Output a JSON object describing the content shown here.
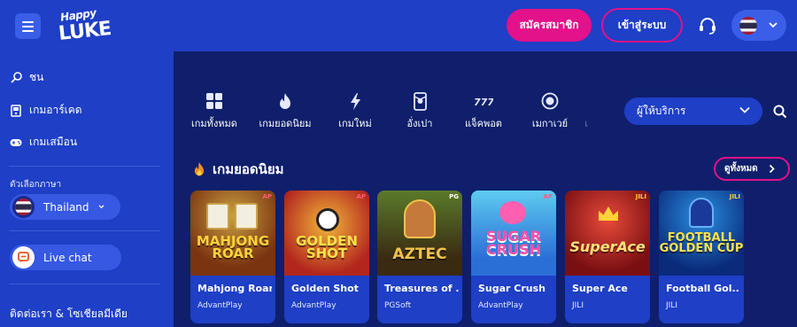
{
  "header": {
    "logo_line1": "Happy",
    "logo_line2": "LUKE",
    "register_label": "สมัครสมาชิก",
    "login_label": "เข้าสู่ระบบ"
  },
  "sidebar": {
    "items": [
      {
        "label": "ชน",
        "icon": "lollipop-icon"
      },
      {
        "label": "เกมอาร์เคด",
        "icon": "arcade-icon"
      },
      {
        "label": "เกมเสมือน",
        "icon": "gamepad-icon"
      }
    ],
    "language_title": "ตัวเลือกภาษา",
    "language_value": "Thailand",
    "live_chat_label": "Live chat",
    "contact_label": "ติดต่อเรา & โซเชียลมีเดีย"
  },
  "categories": [
    {
      "label": "เกมทั้งหมด",
      "icon": "grid-icon"
    },
    {
      "label": "เกมยอดนิยม",
      "icon": "flame-icon"
    },
    {
      "label": "เกมใหม่",
      "icon": "bolt-icon"
    },
    {
      "label": "อั่งเปา",
      "icon": "red-envelope-icon"
    },
    {
      "label": "แจ็คพอต",
      "icon": "777-icon"
    },
    {
      "label": "เมกาเวย์",
      "icon": "megaways-icon"
    },
    {
      "label": "เ",
      "icon": "partial-icon"
    }
  ],
  "provider_filter": {
    "placeholder": "ผู้ให้บริการ"
  },
  "section": {
    "title": "เกมยอดนิยม",
    "see_all_label": "ดูทั้งหมด"
  },
  "games": [
    {
      "name": "Mahjong Roar",
      "provider": "AdvantPlay",
      "badge": "AP",
      "art": "MAHJONG ROAR"
    },
    {
      "name": "Golden Shot",
      "provider": "AdvantPlay",
      "badge": "AP",
      "art": "GOLDEN SHOT"
    },
    {
      "name": "Treasures of ...",
      "provider": "PGSoft",
      "badge": "PG",
      "art": "AZTEC"
    },
    {
      "name": "Sugar Crush",
      "provider": "AdvantPlay",
      "badge": "AP",
      "art": "SUGAR CRUSH"
    },
    {
      "name": "Super Ace",
      "provider": "JILI",
      "badge": "JILI",
      "art": "SuperAce"
    },
    {
      "name": "Football Gol...",
      "provider": "JILI",
      "badge": "JILI",
      "art": "FOOTBALL GOLDEN CUP"
    }
  ],
  "colors": {
    "accent": "#e3118a",
    "header": "#1e3fc6",
    "main_bg": "#0f1f6b"
  }
}
